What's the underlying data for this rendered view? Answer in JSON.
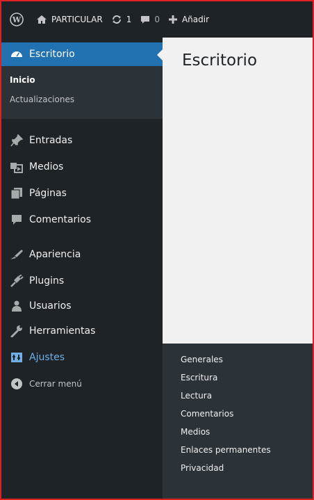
{
  "adminbar": {
    "site_name": "PARTICULAR",
    "updates_count": "1",
    "comments_count": "0",
    "new_label": "Añadir"
  },
  "sidebar": {
    "dashboard_label": "Escritorio",
    "dashboard_sub": [
      "Inicio",
      "Actualizaciones"
    ],
    "items": [
      {
        "label": "Entradas",
        "icon": "pin-icon"
      },
      {
        "label": "Medios",
        "icon": "media-icon"
      },
      {
        "label": "Páginas",
        "icon": "pages-icon"
      },
      {
        "label": "Comentarios",
        "icon": "comment-icon"
      },
      {
        "label": "Apariencia",
        "icon": "brush-icon"
      },
      {
        "label": "Plugins",
        "icon": "plugin-icon"
      },
      {
        "label": "Usuarios",
        "icon": "users-icon"
      },
      {
        "label": "Herramientas",
        "icon": "wrench-icon"
      },
      {
        "label": "Ajustes",
        "icon": "settings-icon"
      }
    ],
    "collapse_label": "Cerrar menú"
  },
  "main": {
    "title": "Escritorio"
  },
  "flyout": {
    "items": [
      "Generales",
      "Escritura",
      "Lectura",
      "Comentarios",
      "Medios",
      "Enlaces permanentes",
      "Privacidad"
    ]
  },
  "colors": {
    "accent": "#2271b1",
    "sidebar": "#1d2327",
    "submenu": "#2c3338",
    "highlight": "#72aee6",
    "border": "#e02020"
  }
}
